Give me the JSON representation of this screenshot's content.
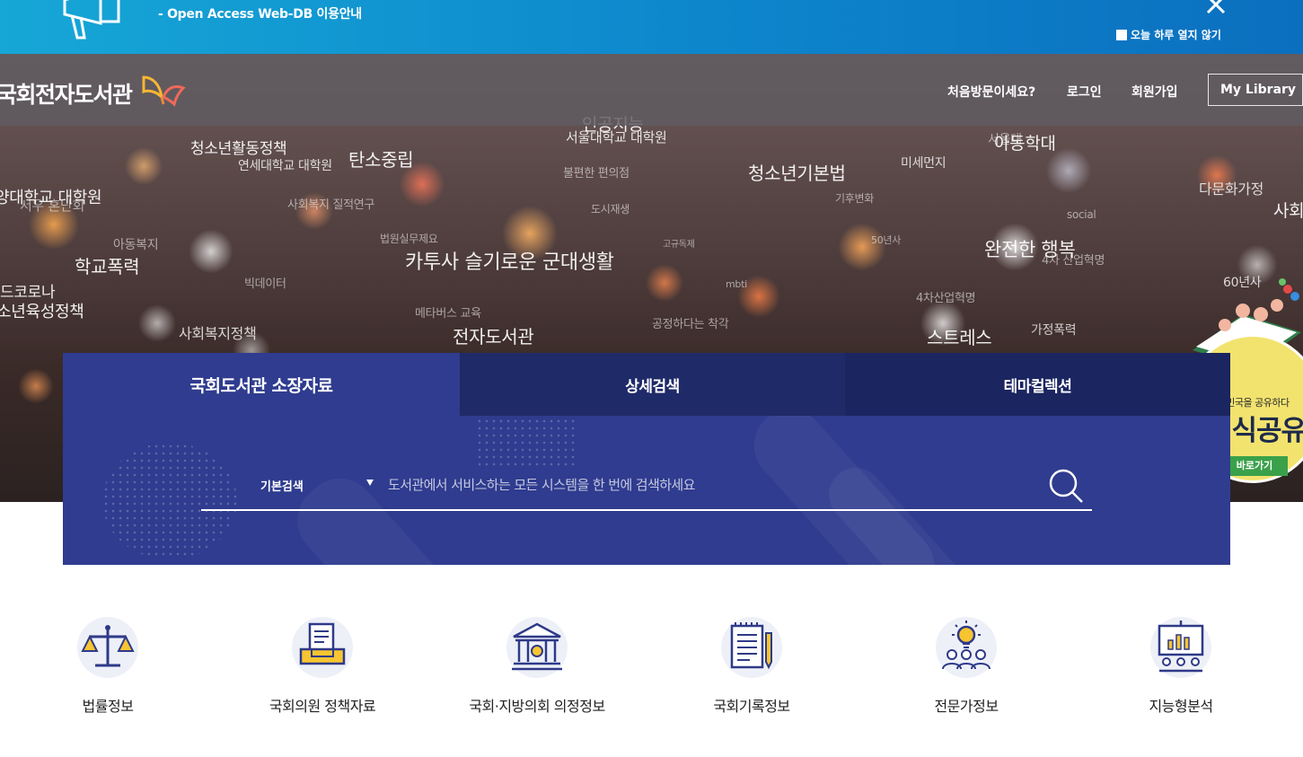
{
  "notice": {
    "text": "- Open Access Web-DB 이용안내",
    "no_more_today": "오늘 하루 열지 않기"
  },
  "header": {
    "logo_text": "국회전자도서관",
    "nav": {
      "first_visit": "처음방문이세요?",
      "login": "로그인",
      "signup": "회원가입",
      "my_library": "My Library"
    }
  },
  "hero": {
    "words": [
      "인공지능",
      "서울대학교 대학원",
      "청소년활동정책",
      "연세대학교 대학원",
      "탄소중립",
      "양대학교 대학원",
      "서우 혼난회",
      "불편한 편의점",
      "청소년기본법",
      "미세먼지",
      "사회복지 질적연구",
      "기후변화",
      "아동학대",
      "다문화가정",
      "사회",
      "아동복지",
      "학교폭력",
      "법원실무제요",
      "도시재생",
      "카투사 슬기로운 군대생활",
      "완전한 행복",
      "social",
      "4차 산업혁명",
      "드코로나",
      "소년육성정책",
      "빅데이터",
      "메타버스 교육",
      "60년사",
      "4차산업혁명",
      "사회복지정책",
      "전자도서관",
      "공정하다는 착각",
      "스트레스",
      "가정폭력",
      "50년사",
      "mbti",
      "고규독제",
      "서울대"
    ]
  },
  "search": {
    "tabs": [
      "국회도서관 소장자료",
      "상세검색",
      "테마컬렉션"
    ],
    "select_value": "기본검색",
    "placeholder": "도서관에서 서비스하는 모든 시스템을 한 번에 검색하세요"
  },
  "badge": {
    "small_text": "대한민국을 공유하다",
    "big_text": "지식공유",
    "go_label": "바로가기"
  },
  "quick_menu": [
    {
      "label": "법률정보",
      "icon": "scales-icon"
    },
    {
      "label": "국회의원 정책자료",
      "icon": "document-tray-icon"
    },
    {
      "label": "국회·지방의회 의정정보",
      "icon": "building-icon"
    },
    {
      "label": "국회기록정보",
      "icon": "notepad-icon"
    },
    {
      "label": "전문가정보",
      "icon": "lightbulb-people-icon"
    },
    {
      "label": "지능형분석",
      "icon": "presentation-chart-icon"
    }
  ],
  "colors": {
    "search_bg": "#2f3c8f",
    "tab_active": "#2f3c8f",
    "tab_inactive": "#1f2a68",
    "icon_accent": "#2e3a88",
    "icon_yellow": "#f7c531"
  }
}
